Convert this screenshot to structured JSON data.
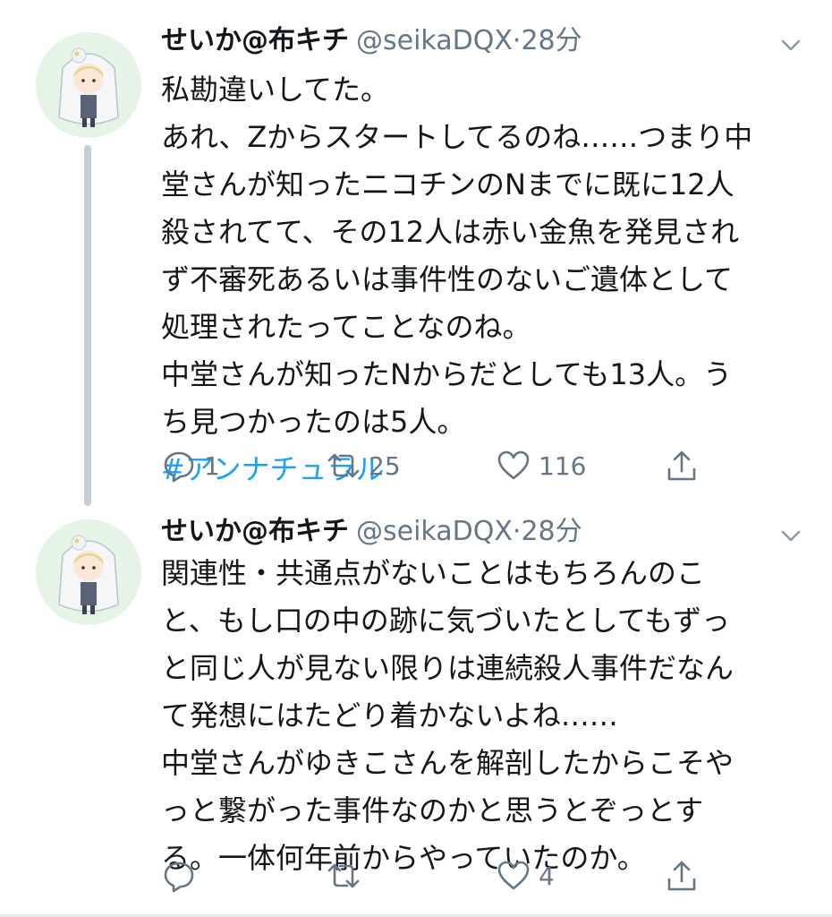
{
  "tweets": [
    {
      "display_name": "せいか@布キチ",
      "handle": "@seikaDQX",
      "separator": "·",
      "time": "28分",
      "lines": [
        "私勘違いしてた。",
        "あれ、Zからスタートしてるのね……つまり中",
        "堂さんが知ったニコチンのNまでに既に12人",
        "殺されてて、その12人は赤い金魚を発見され",
        "ず不審死あるいは事件性のないご遺体として",
        "処理されたってことなのね。",
        "中堂さんが知ったNからだとしても13人。う",
        "ち見つかったのは5人。"
      ],
      "hashtag": "#アンナチュラル",
      "reply_count": "1",
      "retweet_count": "25",
      "like_count": "116",
      "icons": {
        "reply": "reply-icon",
        "retweet": "retweet-icon",
        "like": "heart-icon",
        "share": "share-icon",
        "caret": "chevron-down-icon"
      }
    },
    {
      "display_name": "せいか@布キチ",
      "handle": "@seikaDQX",
      "separator": "·",
      "time": "28分",
      "lines": [
        "関連性・共通点がないことはもちろんのこ",
        "と、もし口の中の跡に気づいたとしてもずっ",
        "と同じ人が見ない限りは連続殺人事件だなん",
        "て発想にはたどり着かないよね……",
        "中堂さんがゆきこさんを解剖したからこそや",
        "っと繋がった事件なのかと思うとぞっとす",
        "る。一体何年前からやっていたのか。"
      ],
      "reply_count": "",
      "retweet_count": "",
      "like_count": "4"
    }
  ],
  "colors": {
    "text": "#14171a",
    "secondary": "#657786",
    "link": "#1da1f2",
    "thread_line": "#c4cfd6",
    "avatar_bg": "#e6f4e8"
  }
}
